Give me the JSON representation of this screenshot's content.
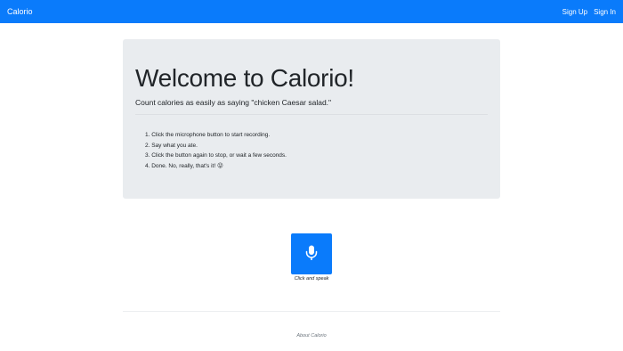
{
  "navbar": {
    "brand": "Calorio",
    "links": [
      "Sign Up",
      "Sign In"
    ]
  },
  "jumbotron": {
    "title": "Welcome to Calorio!",
    "lead": "Count calories as easily as saying \"chicken Caesar salad.\"",
    "steps": [
      "1. Click the microphone button to start recording.",
      "2. Say what you ate.",
      "3. Click the button again to stop, or wait a few seconds.",
      "4. Done. No, really, that's it! 😜"
    ]
  },
  "mic": {
    "icon": "microphone-icon",
    "caption": "Click and speak"
  },
  "footer": {
    "link": "About Calorio"
  },
  "colors": {
    "primary": "#0a7bfb",
    "jumbotron_bg": "#e9ecef"
  }
}
